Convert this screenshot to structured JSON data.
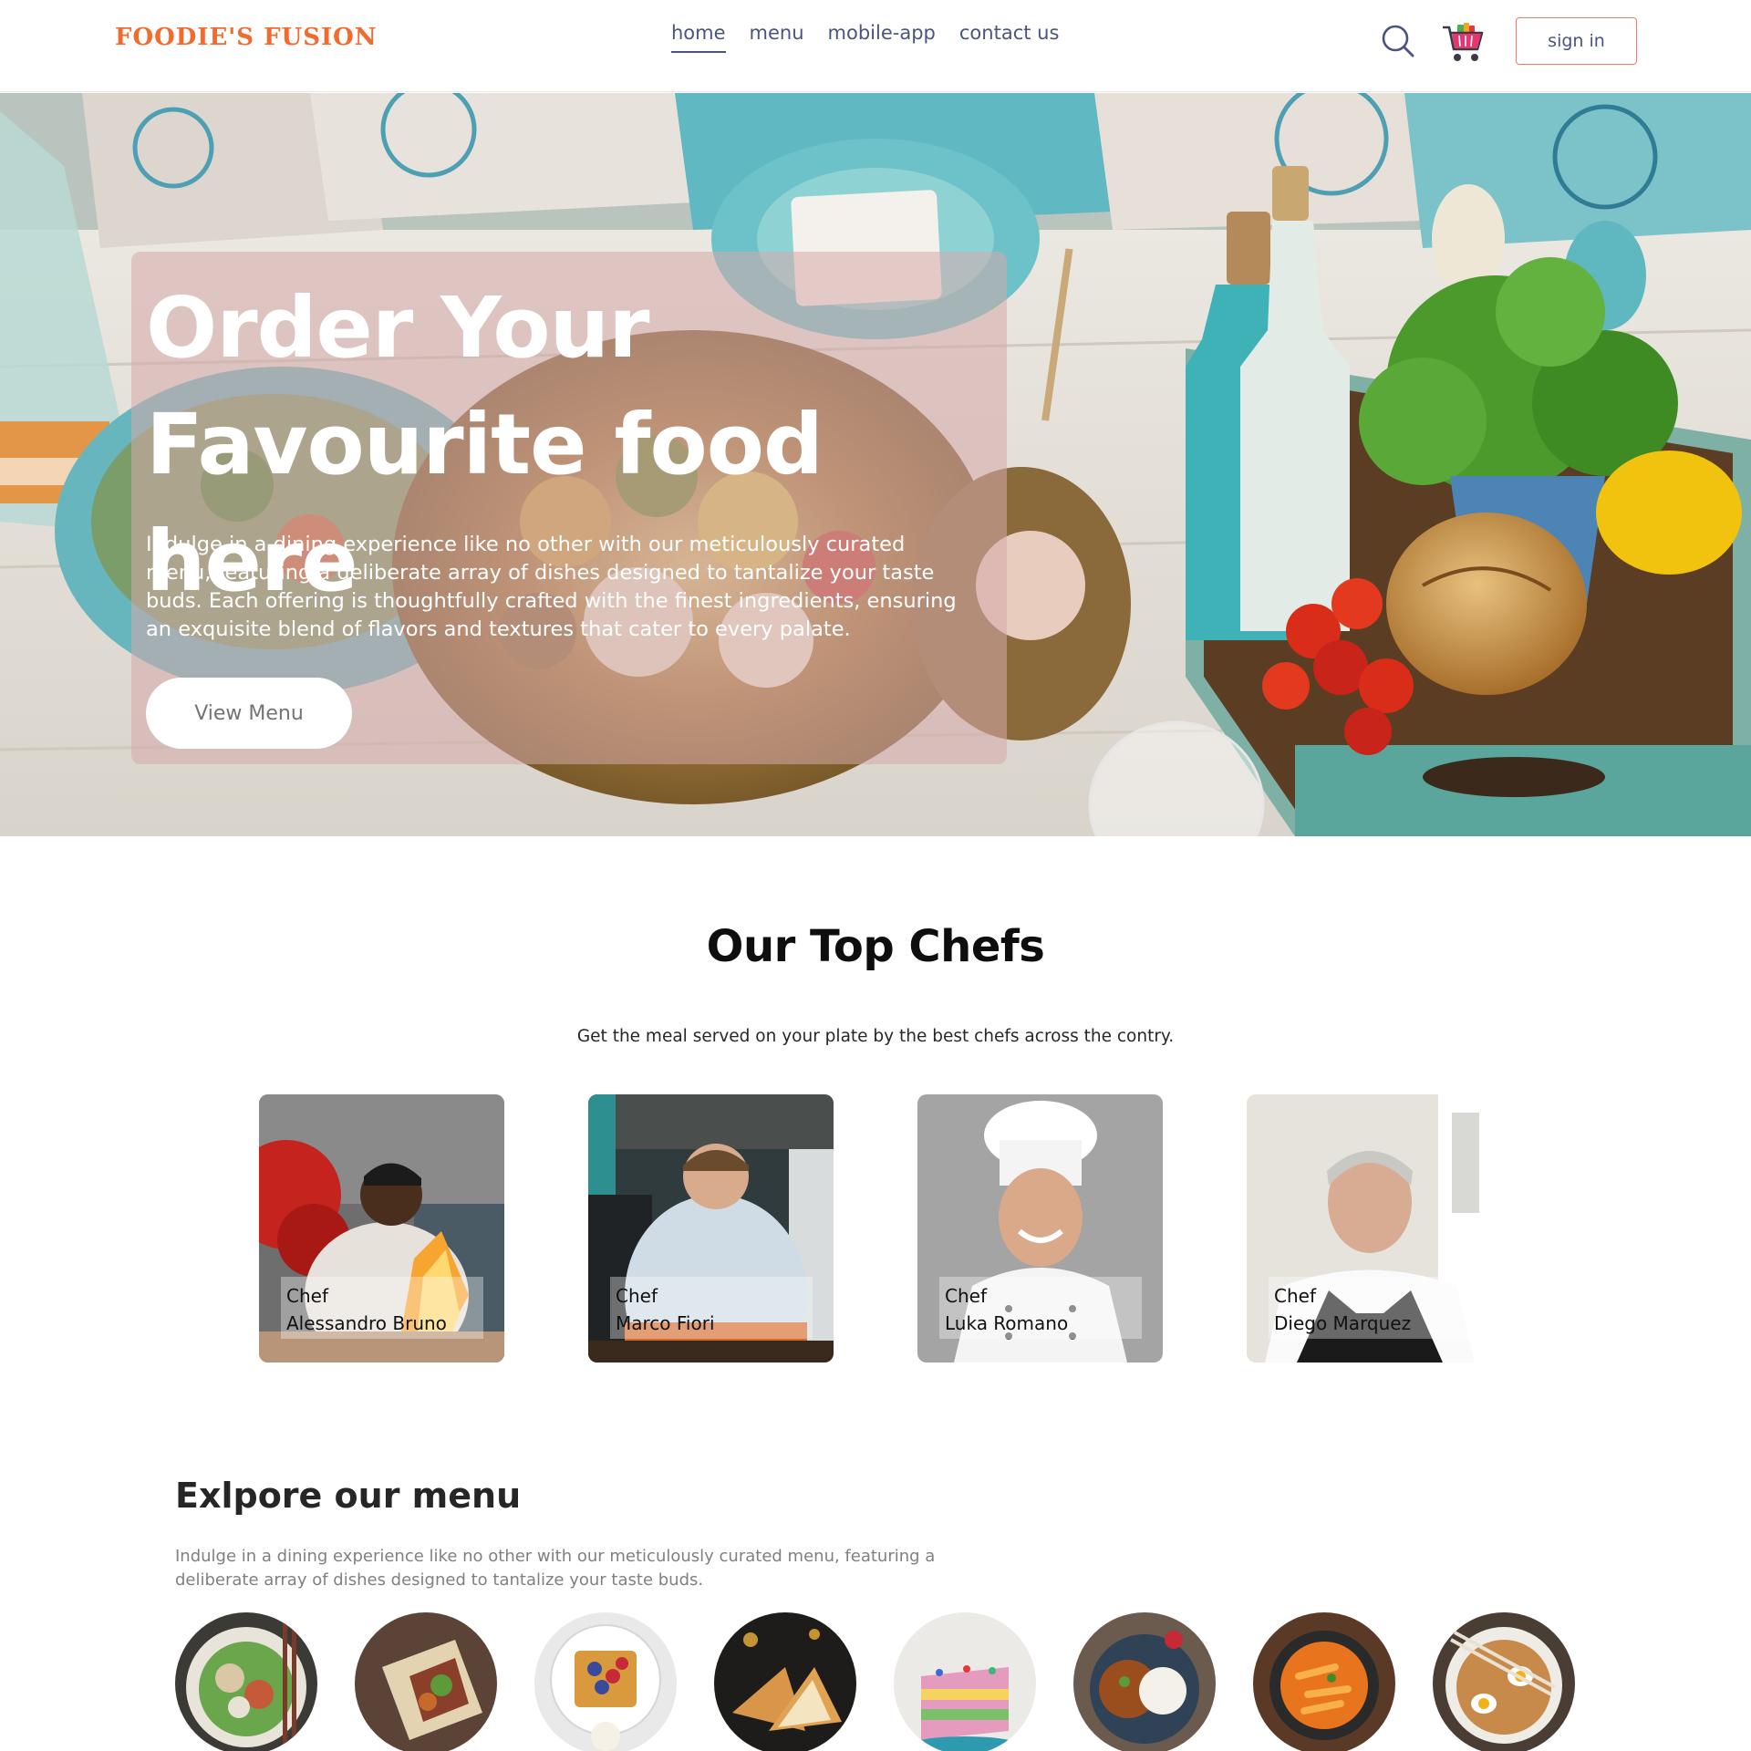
{
  "brand": {
    "logo_text": "FOODIE'S FUSION",
    "accent_color": "#f26a2e"
  },
  "nav": {
    "links": [
      {
        "label": "home",
        "active": true
      },
      {
        "label": "menu",
        "active": false
      },
      {
        "label": "mobile-app",
        "active": false
      },
      {
        "label": "contact us",
        "active": false
      }
    ],
    "search_icon": "search-icon",
    "cart_icon": "cart-icon",
    "signin_label": "sign in"
  },
  "hero": {
    "title_line1": "Order Your",
    "title_line2": "Favourite food here",
    "description": "Indulge in a dining experience like no other with our meticulously curated menu, featuring a deliberate array of dishes designed to tantalize your taste buds. Each offering is thoughtfully crafted with the finest ingredients, ensuring an exquisite blend of flavors and textures that cater to every palate.",
    "button_label": "View Menu"
  },
  "chefs": {
    "title": "Our Top Chefs",
    "subtitle": "Get the meal served on your plate by the best chefs across the contry.",
    "items": [
      {
        "prefix": "Chef",
        "name": "Alessandro Bruno"
      },
      {
        "prefix": "Chef",
        "name": "Marco Fiori"
      },
      {
        "prefix": "Chef",
        "name": "Luka Romano"
      },
      {
        "prefix": "Chef",
        "name": "Diego Marquez"
      }
    ]
  },
  "menu": {
    "title": "Exlpore our menu",
    "description": "Indulge in a dining experience like no other with our meticulously curated menu, featuring a deliberate array of dishes designed to tantalize your taste buds."
  }
}
